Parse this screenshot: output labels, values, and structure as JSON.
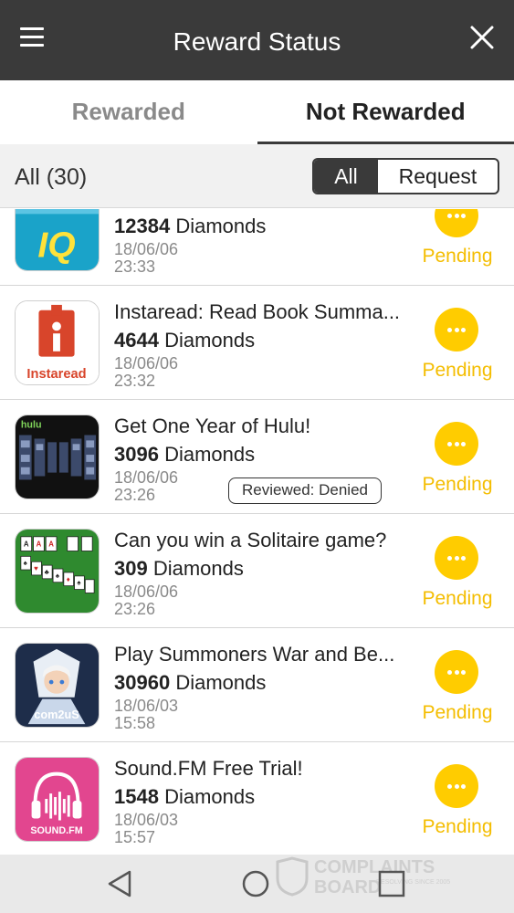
{
  "header": {
    "title": "Reward Status"
  },
  "tabs": {
    "rewarded": "Rewarded",
    "not_rewarded": "Not Rewarded"
  },
  "filter": {
    "count_label": "All (30)",
    "all_label": "All",
    "request_label": "Request"
  },
  "items": [
    {
      "title": "",
      "amount": "12384",
      "unit": "Diamonds",
      "date": "18/06/06",
      "time": "23:33",
      "status": "Pending",
      "icon": "iq-app-icon"
    },
    {
      "title": "Instaread: Read Book Summa...",
      "amount": "4644",
      "unit": "Diamonds",
      "date": "18/06/06",
      "time": "23:32",
      "status": "Pending",
      "icon": "instaread-app-icon",
      "icon_text": "Instaread"
    },
    {
      "title": "Get One Year of Hulu!",
      "amount": "3096",
      "unit": "Diamonds",
      "date": "18/06/06",
      "time": "23:26",
      "status": "Pending",
      "badge": "Reviewed: Denied",
      "icon": "hulu-app-icon",
      "icon_text": "hulu"
    },
    {
      "title": "Can you win a Solitaire game?",
      "amount": "309",
      "unit": "Diamonds",
      "date": "18/06/06",
      "time": "23:26",
      "status": "Pending",
      "icon": "solitaire-app-icon"
    },
    {
      "title": "Play Summoners War and Be...",
      "amount": "30960",
      "unit": "Diamonds",
      "date": "18/06/03",
      "time": "15:58",
      "status": "Pending",
      "icon": "summoners-war-app-icon",
      "icon_text": "com2uS"
    },
    {
      "title": "Sound.FM Free Trial!",
      "amount": "1548",
      "unit": "Diamonds",
      "date": "18/06/03",
      "time": "15:57",
      "status": "Pending",
      "icon": "soundfm-app-icon",
      "icon_text": "SOUND.FM"
    }
  ],
  "watermark": {
    "line1": "COMPLAINTS",
    "line2": "BOARD",
    "tagline": "RESOLVING SINCE 2005"
  },
  "nav": {
    "back_icon": "triangle-back-icon",
    "home_icon": "circle-home-icon",
    "recent_icon": "square-recent-icon"
  },
  "colors": {
    "appbar": "#3a3a3a",
    "pending": "#ffcc00",
    "pending_text": "#f4bd00",
    "nav_background": "#e9e9e9"
  }
}
